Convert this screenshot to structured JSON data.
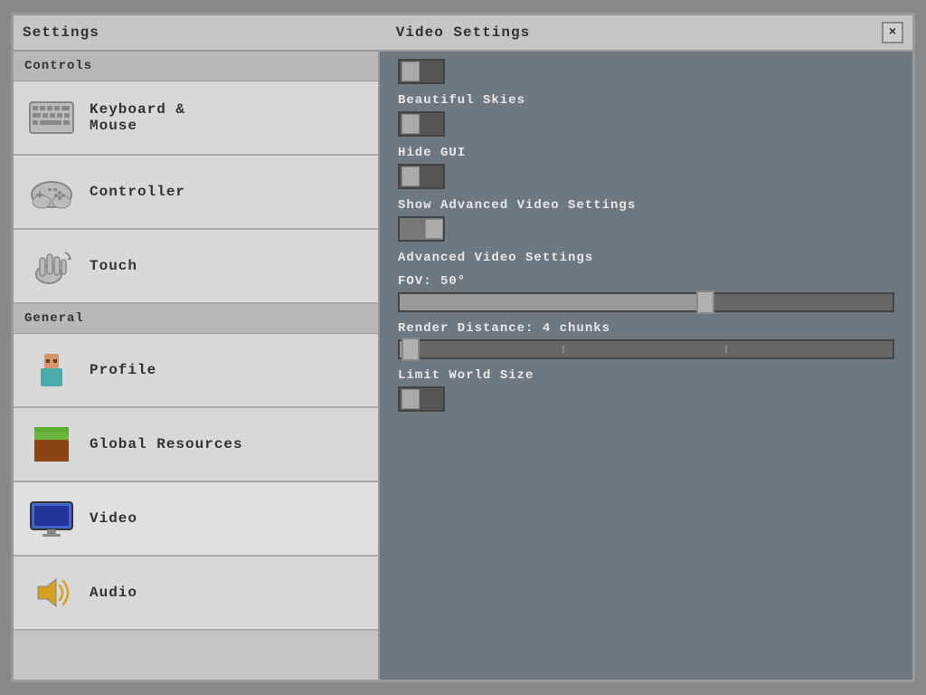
{
  "window": {
    "left_title": "Settings",
    "center_title": "Video Settings",
    "close_label": "×"
  },
  "sidebar": {
    "controls_header": "Controls",
    "general_header": "General",
    "items_controls": [
      {
        "id": "keyboard-mouse",
        "label": "Keyboard &\nMouse"
      },
      {
        "id": "controller",
        "label": "Controller"
      },
      {
        "id": "touch",
        "label": "Touch"
      }
    ],
    "items_general": [
      {
        "id": "profile",
        "label": "Profile"
      },
      {
        "id": "global-resources",
        "label": "Global Resources"
      },
      {
        "id": "video",
        "label": "Video"
      },
      {
        "id": "audio",
        "label": "Audio"
      }
    ]
  },
  "right_panel": {
    "settings": [
      {
        "id": "beautiful-skies",
        "label": "Beautiful Skies",
        "type": "toggle",
        "state": "off"
      },
      {
        "id": "hide-gui",
        "label": "Hide GUI",
        "type": "toggle",
        "state": "off"
      },
      {
        "id": "show-advanced-video",
        "label": "Show Advanced Video Settings",
        "type": "toggle",
        "state": "on"
      },
      {
        "id": "advanced-video-settings",
        "label": "Advanced Video Settings",
        "type": "header"
      },
      {
        "id": "fov",
        "label": "FOV: 50°",
        "type": "slider",
        "value": 50,
        "percent": 62
      },
      {
        "id": "render-distance",
        "label": "Render Distance: 4 chunks",
        "type": "slider",
        "value": 4,
        "percent": 3
      },
      {
        "id": "limit-world-size",
        "label": "Limit World Size",
        "type": "toggle",
        "state": "off"
      }
    ]
  }
}
